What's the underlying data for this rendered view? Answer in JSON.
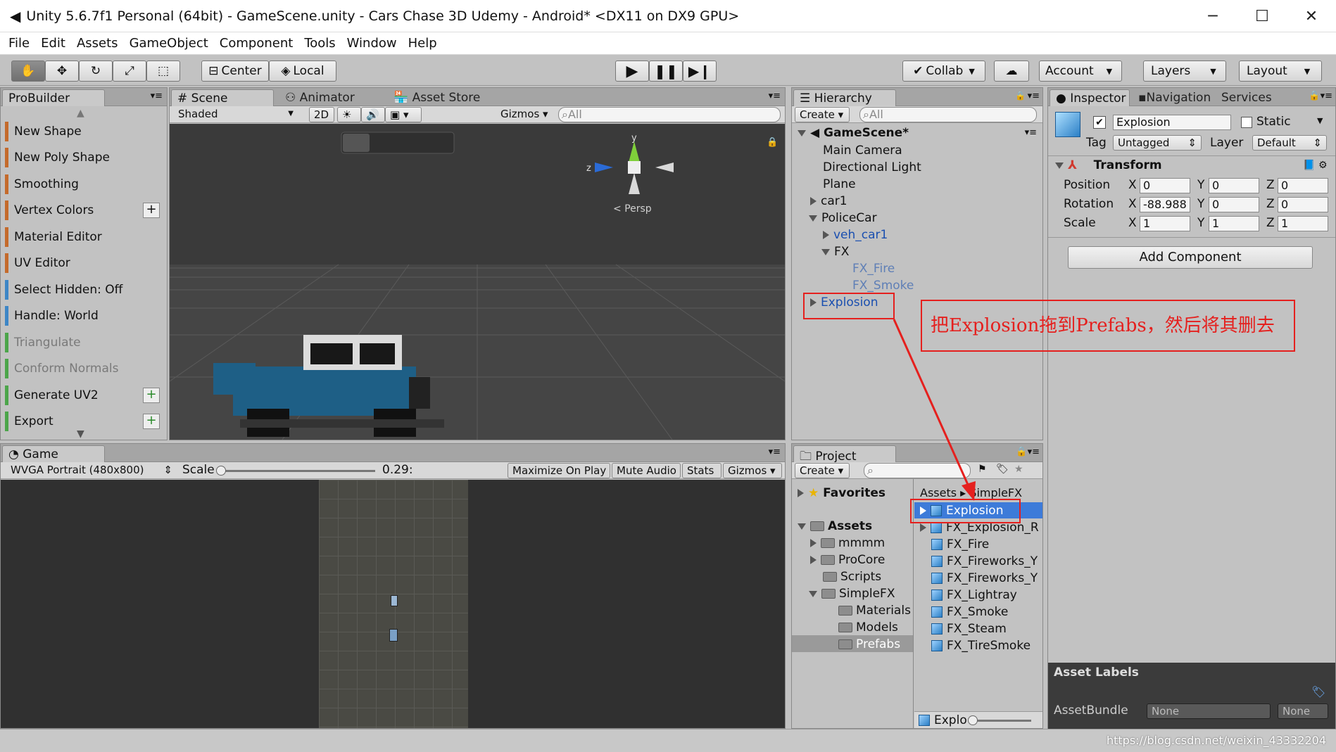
{
  "window": {
    "title": "Unity 5.6.7f1 Personal (64bit) - GameScene.unity - Cars Chase 3D Udemy - Android* <DX11 on DX9 GPU>"
  },
  "menu": [
    "File",
    "Edit",
    "Assets",
    "GameObject",
    "Component",
    "Tools",
    "Window",
    "Help"
  ],
  "toolbar": {
    "center": "Center",
    "local": "Local",
    "collab": "Collab",
    "account": "Account",
    "layers": "Layers",
    "layout": "Layout"
  },
  "probuilder": {
    "tab": "ProBuilder",
    "items": [
      "New Shape",
      "New Poly Shape",
      "Smoothing",
      "Vertex Colors",
      "Material Editor",
      "UV Editor",
      "Select Hidden: Off",
      "Handle: World",
      "Triangulate",
      "Conform Normals",
      "Generate UV2",
      "Export"
    ]
  },
  "scene": {
    "tabs": [
      "Scene",
      "Animator",
      "Asset Store"
    ],
    "shading": "Shaded",
    "mode2d": "2D",
    "gizmos": "Gizmos",
    "search": "All",
    "persp": "Persp",
    "axis_y": "y",
    "axis_z": "z"
  },
  "hierarchy": {
    "tab": "Hierarchy",
    "create": "Create",
    "search": "All",
    "scene": "GameScene*",
    "items": [
      "Main Camera",
      "Directional Light",
      "Plane",
      "car1",
      "PoliceCar",
      "veh_car1",
      "FX",
      "FX_Fire",
      "FX_Smoke",
      "Explosion"
    ]
  },
  "inspector": {
    "tabs": [
      "Inspector",
      "Navigation",
      "Services"
    ],
    "name": "Explosion",
    "static": "Static",
    "tag_label": "Tag",
    "tag": "Untagged",
    "layer_label": "Layer",
    "layer": "Default",
    "transform": "Transform",
    "position_label": "Position",
    "rotation_label": "Rotation",
    "scale_label": "Scale",
    "position": [
      "0",
      "0",
      "0"
    ],
    "rotation": [
      "-88.988",
      "0",
      "0"
    ],
    "scale": [
      "1",
      "1",
      "1"
    ],
    "add_component": "Add Component",
    "asset_labels": "Asset Labels",
    "assetbundle_label": "AssetBundle",
    "assetbundle": "None",
    "assetvariant": "None",
    "axis": [
      "X",
      "Y",
      "Z"
    ]
  },
  "annotation": "把Explosion拖到Prefabs，然后将其删去",
  "game": {
    "tab": "Game",
    "resolution": "WVGA Portrait (480x800)",
    "scale_label": "Scale",
    "scale_value": "0.29:",
    "buttons": [
      "Maximize On Play",
      "Mute Audio",
      "Stats",
      "Gizmos"
    ]
  },
  "project": {
    "tab": "Project",
    "create": "Create",
    "favorites": "Favorites",
    "assets": "Assets",
    "breadcrumb": [
      "Assets",
      "SimpleFX"
    ],
    "tree": [
      "mmmm",
      "ProCore",
      "Scripts",
      "SimpleFX",
      "Materials",
      "Models",
      "Prefabs"
    ],
    "files": [
      "Explosion",
      "FX_Explosion_R",
      "FX_Fire",
      "FX_Fireworks_Y",
      "FX_Fireworks_Y",
      "FX_Lightray",
      "FX_Smoke",
      "FX_Steam",
      "FX_TireSmoke"
    ],
    "bottom": "Explo"
  },
  "watermark": "https://blog.csdn.net/weixin_43332204"
}
